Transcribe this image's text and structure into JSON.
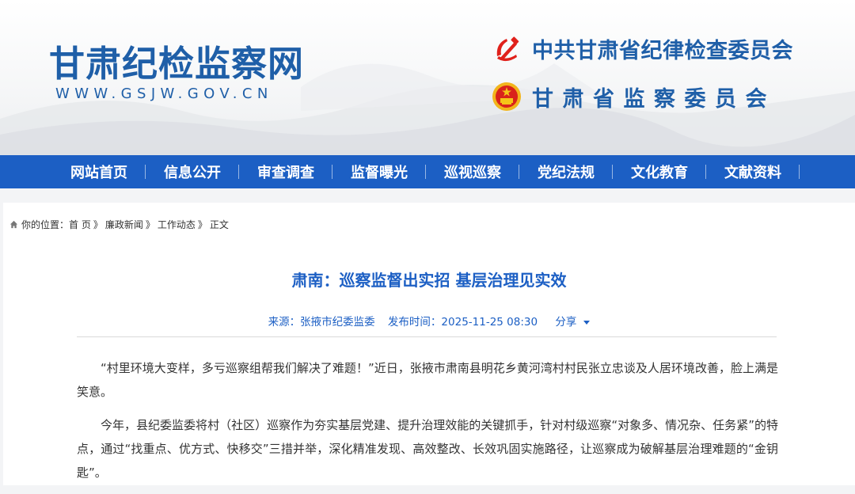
{
  "header": {
    "site_title": "甘肃纪检监察网",
    "site_url": "WWW.GSJW.GOV.CN",
    "org_line_1": "中共甘肃省纪律检查委员会",
    "org_line_2": "甘肃省监察委员会",
    "icons": [
      "party-emblem-icon",
      "national-emblem-icon"
    ],
    "brand_color": "#1f5fa8"
  },
  "nav": {
    "items": [
      "网站首页",
      "信息公开",
      "审查调查",
      "监督曝光",
      "巡视巡察",
      "党纪法规",
      "文化教育",
      "文献资料"
    ],
    "bg_color": "#1c5fc4"
  },
  "breadcrumb": {
    "prefix": "你的位置：",
    "items": [
      "首 页",
      "廉政新闻",
      "工作动态",
      "正文"
    ],
    "separator": "》"
  },
  "article": {
    "title": "肃南：巡察监督出实招 基层治理见实效",
    "source": "来源：张掖市纪委监委",
    "published": "发布时间：2025-11-25 08:30",
    "share_label": "分享",
    "paragraphs": [
      "“村里环境大变样，多亏巡察组帮我们解决了难题！”近日，张掖市肃南县明花乡黄河湾村村民张立忠谈及人居环境改善，脸上满是笑意。",
      "今年，县纪委监委将村（社区）巡察作为夯实基层党建、提升治理效能的关键抓手，针对村级巡察“对象多、情况杂、任务紧”的特点，通过“找重点、优方式、快移交”三措并举，深化精准发现、高效整改、长效巩固实施路径，让巡察成为破解基层治理难题的“金钥匙”。"
    ]
  }
}
